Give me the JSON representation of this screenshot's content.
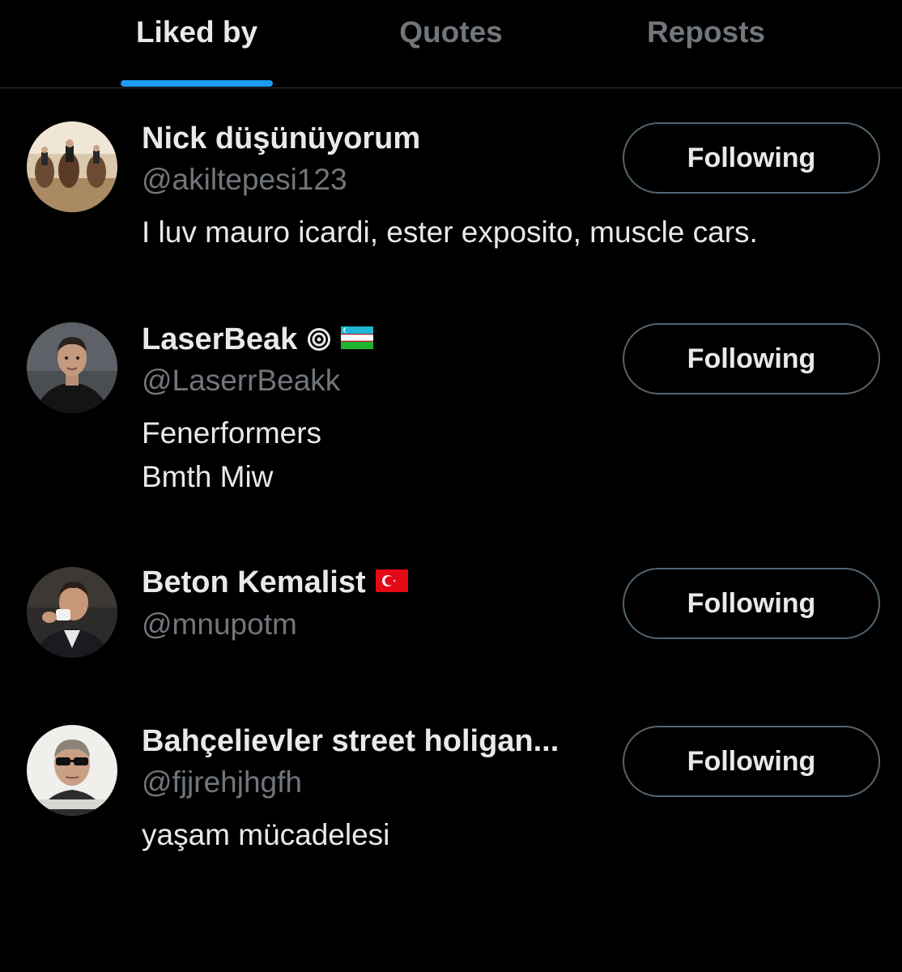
{
  "tabs": [
    {
      "label": "Liked by",
      "active": true
    },
    {
      "label": "Quotes",
      "active": false
    },
    {
      "label": "Reposts",
      "active": false
    }
  ],
  "colors": {
    "background": "#000000",
    "text_primary": "#e7e9ea",
    "text_secondary": "#71767b",
    "accent": "#1d9bf0",
    "border": "#536471"
  },
  "users": [
    {
      "name": "Nick düşünüyorum",
      "handle": "@akiltepesi123",
      "bio": [
        "I luv mauro icardi, ester exposito, muscle cars."
      ],
      "button": "Following",
      "avatar_icon": "cavalry-photo-avatar"
    },
    {
      "name": "LaserBeak",
      "handle": "@LaserrBeakk",
      "bio": [
        "Fenerformers",
        "Bmth Miw"
      ],
      "button": "Following",
      "badges": [
        "target-icon",
        "uzbekistan-flag-icon"
      ],
      "avatar_icon": "man-portrait-avatar"
    },
    {
      "name": "Beton Kemalist",
      "handle": "@mnupotm",
      "bio": [],
      "button": "Following",
      "badges": [
        "turkey-flag-icon"
      ],
      "avatar_icon": "man-drinking-avatar"
    },
    {
      "name": "Bahçelievler street holigan...",
      "handle": "@fjjrehjhgfh",
      "bio": [
        "yaşam mücadelesi"
      ],
      "button": "Following",
      "avatar_icon": "sunglasses-man-avatar"
    }
  ]
}
